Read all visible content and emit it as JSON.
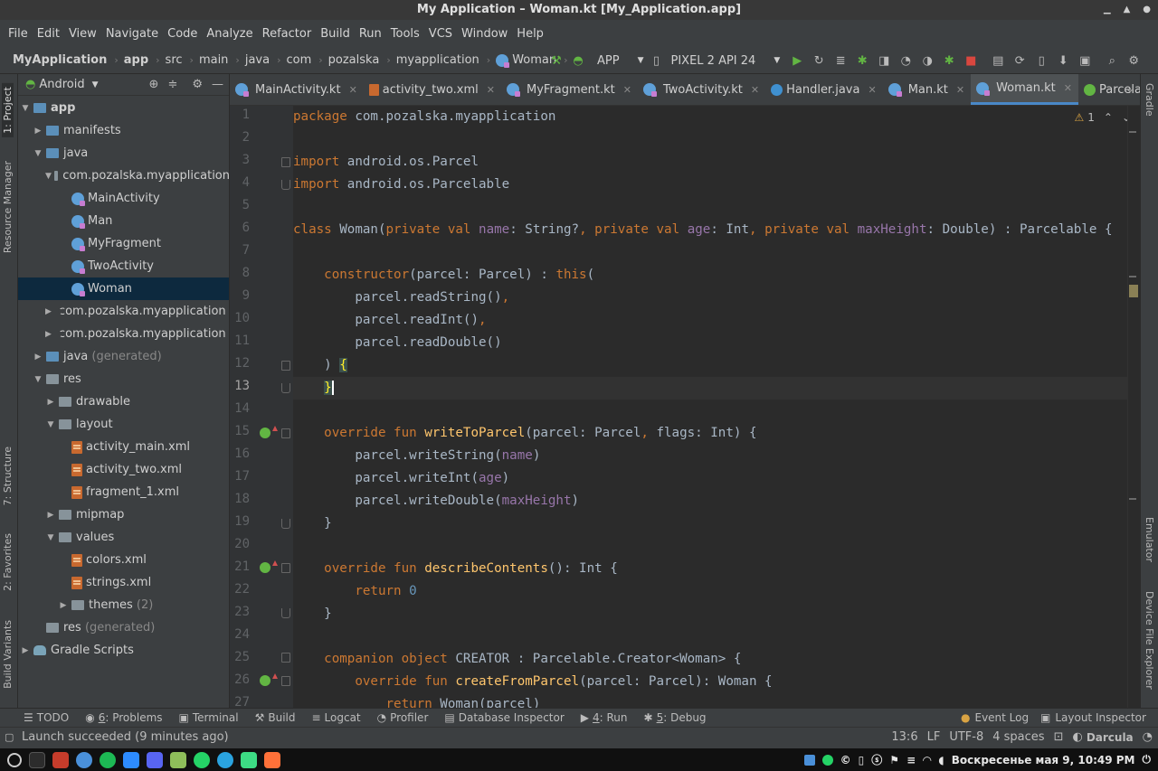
{
  "window": {
    "title": "My Application – Woman.kt [My_Application.app]"
  },
  "menu": [
    "File",
    "Edit",
    "View",
    "Navigate",
    "Code",
    "Analyze",
    "Refactor",
    "Build",
    "Run",
    "Tools",
    "VCS",
    "Window",
    "Help"
  ],
  "breadcrumb": [
    "MyApplication",
    "app",
    "src",
    "main",
    "java",
    "com",
    "pozalska",
    "myapplication",
    "Woman"
  ],
  "toolbar": {
    "run_config": "APP",
    "device": "PIXEL 2 API 24"
  },
  "project_panel": {
    "view_mode": "Android",
    "tree": [
      {
        "label": "app",
        "suffix": ""
      },
      {
        "label": "manifests",
        "suffix": ""
      },
      {
        "label": "java",
        "suffix": ""
      },
      {
        "label": "com.pozalska.myapplication",
        "suffix": ""
      },
      {
        "label": "MainActivity",
        "suffix": ""
      },
      {
        "label": "Man",
        "suffix": ""
      },
      {
        "label": "MyFragment",
        "suffix": ""
      },
      {
        "label": "TwoActivity",
        "suffix": ""
      },
      {
        "label": "Woman",
        "suffix": ""
      },
      {
        "label": "com.pozalska.myapplication",
        "suffix": "("
      },
      {
        "label": "com.pozalska.myapplication",
        "suffix": "("
      },
      {
        "label": "java",
        "suffix": "(generated)"
      },
      {
        "label": "res",
        "suffix": ""
      },
      {
        "label": "drawable",
        "suffix": ""
      },
      {
        "label": "layout",
        "suffix": ""
      },
      {
        "label": "activity_main.xml",
        "suffix": ""
      },
      {
        "label": "activity_two.xml",
        "suffix": ""
      },
      {
        "label": "fragment_1.xml",
        "suffix": ""
      },
      {
        "label": "mipmap",
        "suffix": ""
      },
      {
        "label": "values",
        "suffix": ""
      },
      {
        "label": "colors.xml",
        "suffix": ""
      },
      {
        "label": "strings.xml",
        "suffix": ""
      },
      {
        "label": "themes",
        "suffix": "(2)"
      },
      {
        "label": "res",
        "suffix": "(generated)"
      },
      {
        "label": "Gradle Scripts",
        "suffix": ""
      }
    ]
  },
  "tabs": [
    "MainActivity.kt",
    "activity_two.xml",
    "MyFragment.kt",
    "TwoActivity.kt",
    "Handler.java",
    "Man.kt",
    "Woman.kt",
    "Parcelable.java"
  ],
  "side_tabs": {
    "left": [
      "1: Project",
      "Resource Manager",
      "7: Structure",
      "2: Favorites",
      "Build Variants"
    ],
    "right": [
      "Gradle",
      "Emulator",
      "Device File Explorer"
    ]
  },
  "editor": {
    "inspection_count": "1",
    "lines": [
      "1",
      "2",
      "3",
      "4",
      "5",
      "6",
      "7",
      "8",
      "9",
      "10",
      "11",
      "12",
      "13",
      "14",
      "15",
      "16",
      "17",
      "18",
      "19",
      "20",
      "21",
      "22",
      "23",
      "24",
      "25",
      "26",
      "27"
    ],
    "code": {
      "l1_a": "package",
      "l1_b": " com.pozalska.myapplication",
      "l3_a": "import",
      "l3_b": " android.os.Parcel",
      "l4_a": "import",
      "l4_b": " android.os.Parcelable",
      "l6": {
        "kw_class": "class",
        "name": " Woman(",
        "pv1": "private val",
        "p1": "name",
        "t1": ": String?",
        "pv2": "private val",
        "p2": "age",
        "t2": ": Int",
        "pv3": "private val",
        "p3": "maxHeight",
        "t3": ": Double) : Parcelable {"
      },
      "l8": {
        "kw": "constructor",
        "args": "(parcel: Parcel) : ",
        "this": "this",
        "open": "("
      },
      "l9": "parcel.readString()",
      "l10": "parcel.readInt()",
      "l11": "parcel.readDouble()",
      "l12": {
        "a": ") ",
        "b": "{"
      },
      "l13": "}",
      "l15": {
        "kw": "override fun",
        "fn": "writeToParcel",
        "args": "(parcel: Parcel",
        "args2": " flags: Int) {"
      },
      "l16": {
        "a": "parcel.writeString(",
        "p": "name",
        "b": ")"
      },
      "l17": {
        "a": "parcel.writeInt(",
        "p": "age",
        "b": ")"
      },
      "l18": {
        "a": "parcel.writeDouble(",
        "p": "maxHeight",
        "b": ")"
      },
      "l19": "}",
      "l21": {
        "kw": "override fun",
        "fn": "describeContents",
        "rest": "(): Int {"
      },
      "l22": {
        "kw": "return",
        "num": "0"
      },
      "l23": "}",
      "l25": {
        "kw": "companion object",
        "rest": " CREATOR : Parcelable.Creator<Woman> {"
      },
      "l26": {
        "kw": "override fun",
        "fn": "createFromParcel",
        "rest": "(parcel: Parcel): Woman {"
      },
      "l27": {
        "kw": "return",
        "rest": " Woman(parcel)"
      }
    }
  },
  "bottom_tools": {
    "todo": "TODO",
    "problems_num": "6",
    "problems": ": Problems",
    "terminal": "Terminal",
    "build": "Build",
    "logcat": "Logcat",
    "profiler": "Profiler",
    "database": "Database Inspector",
    "run_num": "4",
    "run": ": Run",
    "debug_num": "5",
    "debug": ": Debug",
    "event_log": "Event Log",
    "layout_inspector": "Layout Inspector"
  },
  "status": {
    "message": "Launch succeeded (9 minutes ago)",
    "position": "13:6",
    "line_sep": "LF",
    "encoding": "UTF-8",
    "indent": "4 spaces",
    "theme": "Darcula"
  },
  "taskbar": {
    "clock": "Воскресенье мая 9, 10:49 PM"
  },
  "colors": {
    "keyword": "#cc7832",
    "function": "#ffc66d",
    "property": "#9876aa",
    "number": "#6897bb",
    "selection": "#0d293e",
    "accent": "#4a88c7"
  }
}
